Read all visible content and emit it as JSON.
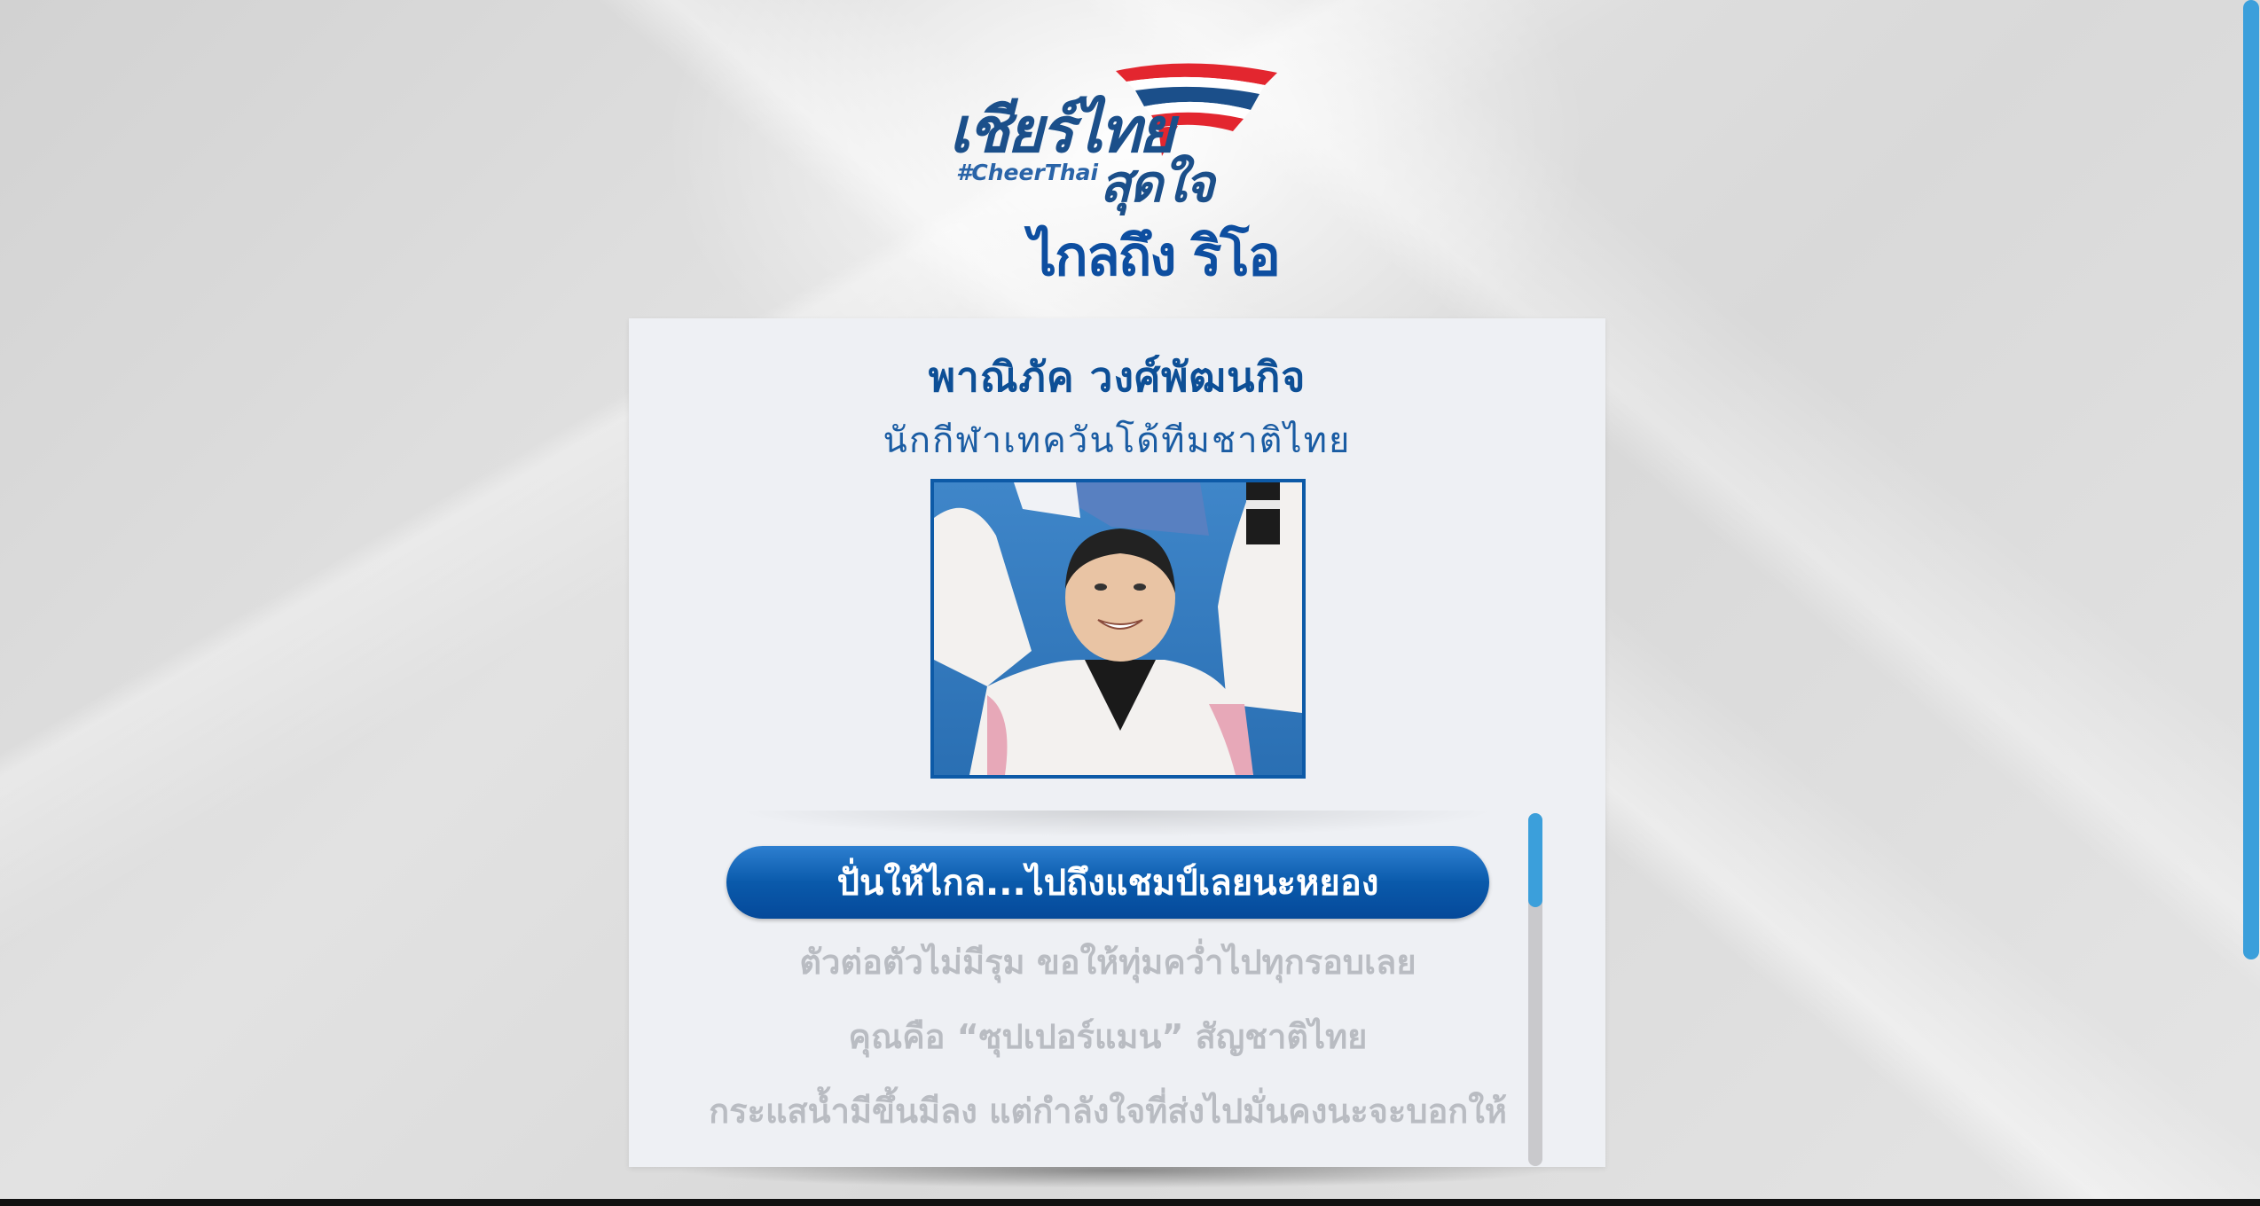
{
  "logo": {
    "main": "เชียร์ไทย",
    "hashtag": "#CheerThai",
    "sub": "สุดใจ",
    "second_line": "ไกลถึง ริโอ",
    "flag_colors": [
      "#e3262f",
      "#ffffff",
      "#1b4f8a"
    ]
  },
  "card": {
    "name": "พาณิภัค  วงศ์พัฒนกิจ",
    "role": "นักกีฬาเทควันโด้ทีมชาติไทย"
  },
  "messages": {
    "selected": "ปั่นให้ไกล...ไปถึงแชมป์เลยนะหยอง",
    "items": [
      "ตัวต่อตัวไม่มีรุม ขอให้ทุ่มคว่ำไปทุกรอบเลย",
      "คุณคือ “ซุปเปอร์แมน” สัญชาติไทย",
      "กระแสน้ำมีขึ้นมีลง แต่กำลังใจที่ส่งไปมั่นคงนะจะบอกให้"
    ]
  },
  "colors": {
    "accent": "#0d5aa7",
    "scroll": "#3b9fdb",
    "faded_text": "#b9bcc2"
  }
}
